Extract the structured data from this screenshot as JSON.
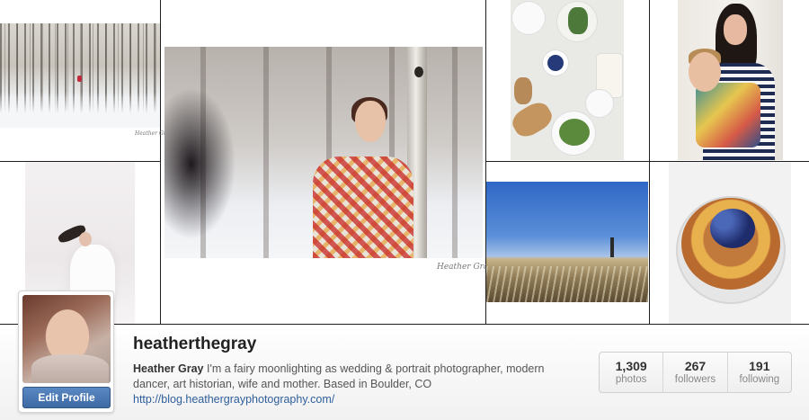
{
  "profile": {
    "username": "heatherthegray",
    "full_name": "Heather Gray",
    "bio": " I'm a fairy moonlighting as wedding & portrait photographer, modern dancer, art historian, wife and mother. Based in Boulder, CO",
    "website": "http://blog.heathergrayphotography.com/",
    "edit_profile_label": "Edit Profile"
  },
  "stats": [
    {
      "value": "1,309",
      "label": "photos"
    },
    {
      "value": "267",
      "label": "followers"
    },
    {
      "value": "191",
      "label": "following"
    }
  ],
  "photos": {
    "signature": "Heather Gray"
  }
}
